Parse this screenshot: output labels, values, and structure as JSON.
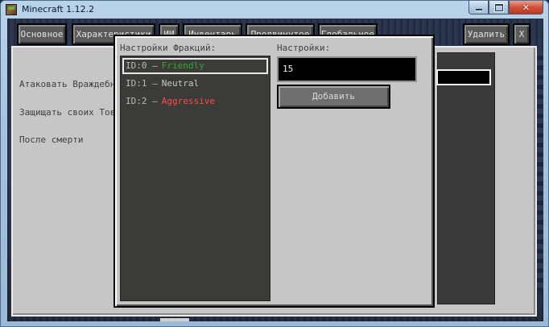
{
  "window": {
    "title": "Minecraft 1.12.2",
    "controls": {
      "minimize": "minimize",
      "maximize": "maximize",
      "close": "close"
    }
  },
  "tabs": [
    {
      "label": "Основное"
    },
    {
      "label": "Характеристики"
    },
    {
      "label": "ИИ"
    },
    {
      "label": "Инвентарь"
    },
    {
      "label": "Продвинутое"
    },
    {
      "label": "Глобальное"
    }
  ],
  "top_right": {
    "delete_label": "Удалить",
    "close_label": "X"
  },
  "background_panel": {
    "labels": [
      "Атаковать Враждебные",
      "Защищать своих Това",
      "После смерти"
    ]
  },
  "dialog": {
    "factions_header": "Настройки Фракций:",
    "settings_header": "Настройки:",
    "factions": [
      {
        "id": "ID:0",
        "name": "Friendly",
        "color": "#2fa82f",
        "selected": true
      },
      {
        "id": "ID:1",
        "name": "Neutral",
        "color": "#c8c8c8",
        "selected": false
      },
      {
        "id": "ID:2",
        "name": "Aggressive",
        "color": "#ff4b4b",
        "selected": false
      }
    ],
    "input_value": "15",
    "add_label": "Добавить"
  }
}
